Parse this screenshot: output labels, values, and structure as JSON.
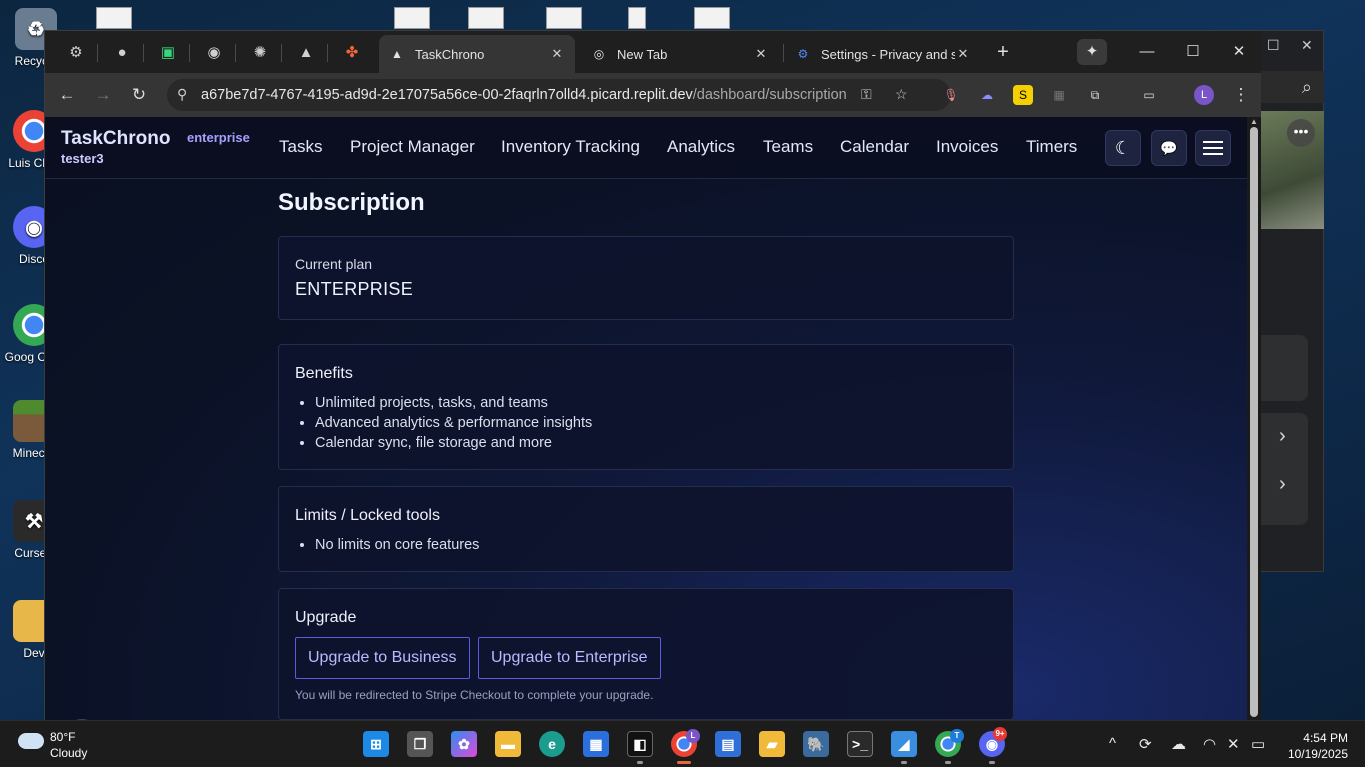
{
  "desktop": {
    "icons": [
      {
        "label": "Recycle"
      },
      {
        "label": "Luis Chro"
      },
      {
        "label": "Disco"
      },
      {
        "label": "Goog Chro"
      },
      {
        "label": "Minecra"
      },
      {
        "label": "CurseF"
      },
      {
        "label": "Dev"
      }
    ]
  },
  "browser": {
    "tabs": [
      {
        "title": "TaskChrono",
        "active": true
      },
      {
        "title": "New Tab",
        "active": false
      },
      {
        "title": "Settings - Privacy and se",
        "active": false
      }
    ],
    "url_host": "a67be7d7-4767-4195-ad9d-2e17075a56ce-00-2faqrln7olld4.picard.replit.dev",
    "url_path": "/dashboard/subscription",
    "profile_initial": "L"
  },
  "app": {
    "brand": "TaskChrono",
    "plan_tag": "enterprise",
    "username": "tester3",
    "nav": [
      "Tasks",
      "Project Manager",
      "Inventory Tracking",
      "Analytics",
      "Teams",
      "Calendar",
      "Invoices",
      "Timers"
    ]
  },
  "page": {
    "title": "Subscription",
    "current_plan": {
      "label": "Current plan",
      "value": "ENTERPRISE"
    },
    "benefits": {
      "heading": "Benefits",
      "items": [
        "Unlimited projects, tasks, and teams",
        "Advanced analytics & performance insights",
        "Calendar sync, file storage and more"
      ]
    },
    "limits": {
      "heading": "Limits / Locked tools",
      "items": [
        "No limits on core features"
      ]
    },
    "upgrade": {
      "heading": "Upgrade",
      "business_label": "Upgrade to Business",
      "enterprise_label": "Upgrade to Enterprise",
      "note": "You will be redirected to Stripe Checkout to complete your upgrade."
    },
    "next_badge": "N"
  },
  "taskbar": {
    "weather_temp": "80°F",
    "weather_cond": "Cloudy",
    "chrome_badge": "L",
    "chrome2_badge": "T",
    "discord_badge": "9+",
    "time": "4:54 PM",
    "date": "10/19/2025"
  },
  "colors": {
    "accent": "#5a5ce0",
    "accent_text": "#b8bbff",
    "page_bg": "#0b1226",
    "brand_tag": "#a6a0ff"
  }
}
